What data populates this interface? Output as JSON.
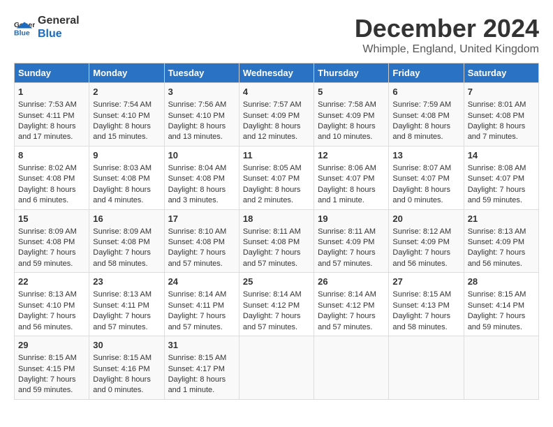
{
  "logo": {
    "text_general": "General",
    "text_blue": "Blue"
  },
  "title": "December 2024",
  "location": "Whimple, England, United Kingdom",
  "days_of_week": [
    "Sunday",
    "Monday",
    "Tuesday",
    "Wednesday",
    "Thursday",
    "Friday",
    "Saturday"
  ],
  "weeks": [
    [
      {
        "day": "1",
        "sunrise": "7:53 AM",
        "sunset": "4:11 PM",
        "daylight": "8 hours and 17 minutes."
      },
      {
        "day": "2",
        "sunrise": "7:54 AM",
        "sunset": "4:10 PM",
        "daylight": "8 hours and 15 minutes."
      },
      {
        "day": "3",
        "sunrise": "7:56 AM",
        "sunset": "4:10 PM",
        "daylight": "8 hours and 13 minutes."
      },
      {
        "day": "4",
        "sunrise": "7:57 AM",
        "sunset": "4:09 PM",
        "daylight": "8 hours and 12 minutes."
      },
      {
        "day": "5",
        "sunrise": "7:58 AM",
        "sunset": "4:09 PM",
        "daylight": "8 hours and 10 minutes."
      },
      {
        "day": "6",
        "sunrise": "7:59 AM",
        "sunset": "4:08 PM",
        "daylight": "8 hours and 8 minutes."
      },
      {
        "day": "7",
        "sunrise": "8:01 AM",
        "sunset": "4:08 PM",
        "daylight": "8 hours and 7 minutes."
      }
    ],
    [
      {
        "day": "8",
        "sunrise": "8:02 AM",
        "sunset": "4:08 PM",
        "daylight": "8 hours and 6 minutes."
      },
      {
        "day": "9",
        "sunrise": "8:03 AM",
        "sunset": "4:08 PM",
        "daylight": "8 hours and 4 minutes."
      },
      {
        "day": "10",
        "sunrise": "8:04 AM",
        "sunset": "4:08 PM",
        "daylight": "8 hours and 3 minutes."
      },
      {
        "day": "11",
        "sunrise": "8:05 AM",
        "sunset": "4:07 PM",
        "daylight": "8 hours and 2 minutes."
      },
      {
        "day": "12",
        "sunrise": "8:06 AM",
        "sunset": "4:07 PM",
        "daylight": "8 hours and 1 minute."
      },
      {
        "day": "13",
        "sunrise": "8:07 AM",
        "sunset": "4:07 PM",
        "daylight": "8 hours and 0 minutes."
      },
      {
        "day": "14",
        "sunrise": "8:08 AM",
        "sunset": "4:07 PM",
        "daylight": "7 hours and 59 minutes."
      }
    ],
    [
      {
        "day": "15",
        "sunrise": "8:09 AM",
        "sunset": "4:08 PM",
        "daylight": "7 hours and 59 minutes."
      },
      {
        "day": "16",
        "sunrise": "8:09 AM",
        "sunset": "4:08 PM",
        "daylight": "7 hours and 58 minutes."
      },
      {
        "day": "17",
        "sunrise": "8:10 AM",
        "sunset": "4:08 PM",
        "daylight": "7 hours and 57 minutes."
      },
      {
        "day": "18",
        "sunrise": "8:11 AM",
        "sunset": "4:08 PM",
        "daylight": "7 hours and 57 minutes."
      },
      {
        "day": "19",
        "sunrise": "8:11 AM",
        "sunset": "4:09 PM",
        "daylight": "7 hours and 57 minutes."
      },
      {
        "day": "20",
        "sunrise": "8:12 AM",
        "sunset": "4:09 PM",
        "daylight": "7 hours and 56 minutes."
      },
      {
        "day": "21",
        "sunrise": "8:13 AM",
        "sunset": "4:09 PM",
        "daylight": "7 hours and 56 minutes."
      }
    ],
    [
      {
        "day": "22",
        "sunrise": "8:13 AM",
        "sunset": "4:10 PM",
        "daylight": "7 hours and 56 minutes."
      },
      {
        "day": "23",
        "sunrise": "8:13 AM",
        "sunset": "4:11 PM",
        "daylight": "7 hours and 57 minutes."
      },
      {
        "day": "24",
        "sunrise": "8:14 AM",
        "sunset": "4:11 PM",
        "daylight": "7 hours and 57 minutes."
      },
      {
        "day": "25",
        "sunrise": "8:14 AM",
        "sunset": "4:12 PM",
        "daylight": "7 hours and 57 minutes."
      },
      {
        "day": "26",
        "sunrise": "8:14 AM",
        "sunset": "4:12 PM",
        "daylight": "7 hours and 57 minutes."
      },
      {
        "day": "27",
        "sunrise": "8:15 AM",
        "sunset": "4:13 PM",
        "daylight": "7 hours and 58 minutes."
      },
      {
        "day": "28",
        "sunrise": "8:15 AM",
        "sunset": "4:14 PM",
        "daylight": "7 hours and 59 minutes."
      }
    ],
    [
      {
        "day": "29",
        "sunrise": "8:15 AM",
        "sunset": "4:15 PM",
        "daylight": "7 hours and 59 minutes."
      },
      {
        "day": "30",
        "sunrise": "8:15 AM",
        "sunset": "4:16 PM",
        "daylight": "8 hours and 0 minutes."
      },
      {
        "day": "31",
        "sunrise": "8:15 AM",
        "sunset": "4:17 PM",
        "daylight": "8 hours and 1 minute."
      },
      null,
      null,
      null,
      null
    ]
  ]
}
